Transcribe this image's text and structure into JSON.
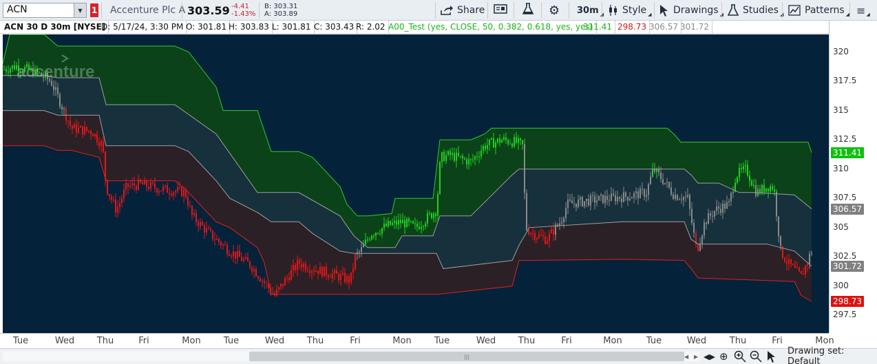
{
  "toolbar": {
    "symbol": "ACN",
    "link_badge": "1",
    "company_name": "Accenture Plc A",
    "last_price": "303.59",
    "change": "-4.41",
    "change_pct": "-1.43%",
    "bid": "B: 303.31",
    "ask": "A: 303.89",
    "share_label": "Share",
    "timeframe_label": "30m",
    "style_label": "Style",
    "drawings_label": "Drawings",
    "studies_label": "Studies",
    "patterns_label": "Patterns"
  },
  "infobar": {
    "title": "ACN 30 D 30m [NYSE]",
    "date": "D: 5/17/24, 3:30 PM",
    "open": "O: 301.81",
    "high": "H: 303.83",
    "low": "L: 301.81",
    "close": "C: 303.43",
    "range": "R: 2.02",
    "study": "A00_Test (yes, CLOSE, 50, 0.382, 0.618, yes, yes)",
    "study_values": [
      "311.41",
      "298.73",
      "306.57",
      "301.72"
    ]
  },
  "watermark": "accenture",
  "price_axis": {
    "ticks": [
      "320",
      "317.5",
      "315",
      "312.5",
      "310",
      "307.5",
      "305",
      "302.5",
      "300",
      "297.5"
    ],
    "labels": [
      {
        "text": "311.41",
        "color": "#10c010"
      },
      {
        "text": "306.57",
        "color": "#808080"
      },
      {
        "text": "301.72",
        "color": "#808080"
      },
      {
        "text": "298.73",
        "color": "#e01010"
      }
    ]
  },
  "time_axis": {
    "ticks": [
      "Tue",
      "Wed",
      "Thu",
      "Fri",
      "Mon",
      "Tue",
      "Wed",
      "Thu",
      "Fri",
      "Mon",
      "Tue",
      "Wed",
      "Thu",
      "Fri",
      "Mon",
      "Tue",
      "Wed",
      "Thu",
      "Fri",
      "Mon"
    ]
  },
  "bottombar": {
    "drawing_set_label": "Drawing set: Default"
  },
  "colors": {
    "background": "#04223a",
    "upper_zone": "#0b4219",
    "middle_zone": "#16303c",
    "lower_zone": "#2b2026",
    "up_line": "#2ecc2e",
    "down_line": "#e02020",
    "mid_line": "#a0a0a0"
  },
  "chart_data": {
    "type": "line",
    "title": "ACN 30 D 30m [NYSE]",
    "ylim": [
      296,
      321.5
    ],
    "xlabel": "",
    "ylabel": "",
    "x_ticks": [
      "Tue",
      "Wed",
      "Thu",
      "Fri",
      "Mon",
      "Tue",
      "Wed",
      "Thu",
      "Fri",
      "Mon",
      "Tue",
      "Wed",
      "Thu",
      "Fri",
      "Mon",
      "Tue",
      "Wed",
      "Thu",
      "Fri",
      "Mon"
    ],
    "x_tick_index": [
      26,
      90,
      149,
      205,
      274,
      332,
      395,
      454,
      512,
      580,
      638,
      702,
      761,
      819,
      886,
      946,
      1008,
      1068,
      1125,
      1194
    ],
    "series": [
      {
        "name": "",
        "color": "#2ecc2e",
        "x": [
          0,
          10,
          60,
          80,
          140,
          250,
          270,
          310,
          320,
          370,
          390,
          430,
          450,
          490,
          500,
          515,
          530,
          565,
          570,
          625,
          635,
          680,
          700,
          710,
          965,
          975,
          985,
          1170,
          1175
        ],
        "values": [
          319,
          321.5,
          321.5,
          320.5,
          320.5,
          320.5,
          320,
          317,
          315,
          315,
          311.5,
          311.5,
          311,
          308.5,
          307,
          306,
          306,
          306.2,
          307.5,
          307.5,
          312.5,
          312.5,
          313,
          313.5,
          313.5,
          313,
          312.3,
          312.3,
          311.4
        ]
      },
      {
        "name": "",
        "color": "#a0a0a0",
        "x": [
          0,
          60,
          80,
          140,
          150,
          250,
          310,
          340,
          370,
          430,
          490,
          510,
          530,
          570,
          580,
          625,
          635,
          680,
          740,
          750,
          990,
          1000,
          1010,
          1040,
          1070,
          1090,
          1150,
          1175
        ],
        "values": [
          318,
          318,
          317.8,
          317.8,
          315.5,
          315.5,
          313,
          310.5,
          308,
          308,
          306,
          304.3,
          303.3,
          303.3,
          304.3,
          304.3,
          306,
          306,
          309.5,
          310,
          310,
          309.5,
          308.8,
          308.8,
          308,
          308,
          307.8,
          306.6
        ]
      },
      {
        "name": "",
        "color": "#a0a0a0",
        "x": [
          0,
          60,
          80,
          100,
          140,
          150,
          250,
          270,
          310,
          330,
          370,
          390,
          430,
          450,
          490,
          510,
          630,
          640,
          740,
          750,
          765,
          900,
          990,
          1000,
          1010,
          1110,
          1150,
          1175
        ],
        "values": [
          315,
          315,
          314.6,
          314.6,
          314.6,
          312,
          312,
          311.5,
          309,
          307.5,
          306.3,
          305.5,
          305.5,
          304.5,
          303,
          302.8,
          302.8,
          301.5,
          302.2,
          303.5,
          305,
          305.5,
          305.5,
          304,
          303.6,
          303.6,
          303,
          301.7
        ]
      },
      {
        "name": "",
        "color": "#e02020",
        "x": [
          0,
          60,
          80,
          100,
          140,
          150,
          250,
          270,
          310,
          330,
          370,
          380,
          390,
          430,
          450,
          490,
          510,
          630,
          740,
          750,
          765,
          900,
          990,
          1000,
          1010,
          1150,
          1160,
          1175
        ],
        "values": [
          312,
          312,
          311.6,
          311.6,
          311,
          309,
          309,
          308,
          305.5,
          305,
          303.3,
          302,
          299.3,
          299.3,
          299.3,
          299.3,
          299.3,
          299.3,
          300,
          302.2,
          302.2,
          302.3,
          302.2,
          301.5,
          300.7,
          300.4,
          299.2,
          298.7
        ]
      }
    ]
  }
}
